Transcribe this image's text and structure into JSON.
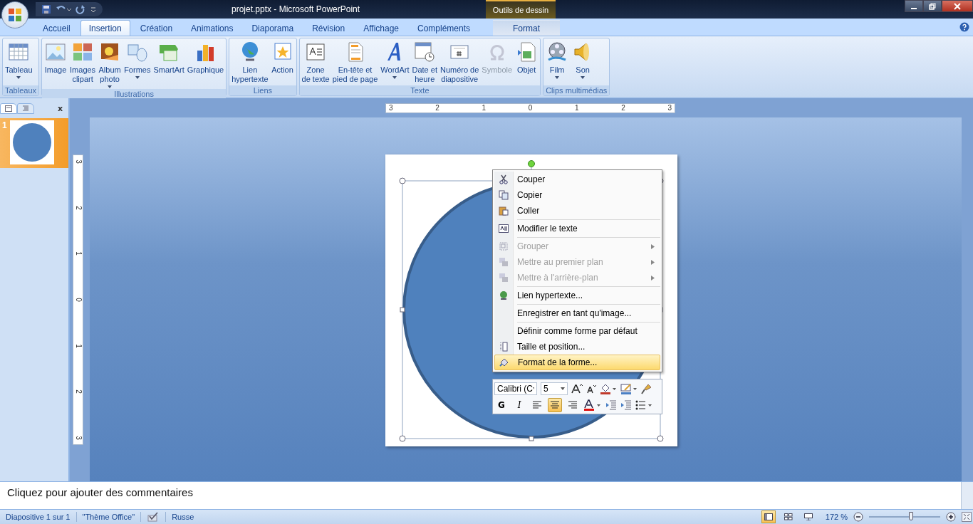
{
  "window": {
    "title": "projet.pptx - Microsoft PowerPoint",
    "contextual_title": "Outils de dessin"
  },
  "tabs": [
    {
      "label": "Accueil",
      "selected": false,
      "contextual": false
    },
    {
      "label": "Insertion",
      "selected": true,
      "contextual": false
    },
    {
      "label": "Création",
      "selected": false,
      "contextual": false
    },
    {
      "label": "Animations",
      "selected": false,
      "contextual": false
    },
    {
      "label": "Diaporama",
      "selected": false,
      "contextual": false
    },
    {
      "label": "Révision",
      "selected": false,
      "contextual": false
    },
    {
      "label": "Affichage",
      "selected": false,
      "contextual": false
    },
    {
      "label": "Compléments",
      "selected": false,
      "contextual": false
    },
    {
      "label": "Format",
      "selected": false,
      "contextual": true
    }
  ],
  "ribbon_groups": [
    {
      "label": "Tableaux",
      "buttons": [
        {
          "kind": "table",
          "lines": [
            "Tableau"
          ],
          "dropdown": true,
          "disabled": false
        }
      ]
    },
    {
      "label": "Illustrations",
      "buttons": [
        {
          "kind": "image",
          "lines": [
            "Image"
          ],
          "dropdown": false,
          "disabled": false
        },
        {
          "kind": "clipart",
          "lines": [
            "Images",
            "clipart"
          ],
          "dropdown": false,
          "disabled": false
        },
        {
          "kind": "album",
          "lines": [
            "Album",
            "photo"
          ],
          "dropdown": true,
          "disabled": false
        },
        {
          "kind": "shapes",
          "lines": [
            "Formes"
          ],
          "dropdown": true,
          "disabled": false
        },
        {
          "kind": "smartart",
          "lines": [
            "SmartArt"
          ],
          "dropdown": false,
          "disabled": false
        },
        {
          "kind": "chart",
          "lines": [
            "Graphique"
          ],
          "dropdown": false,
          "disabled": false
        }
      ]
    },
    {
      "label": "Liens",
      "buttons": [
        {
          "kind": "link",
          "lines": [
            "Lien",
            "hypertexte"
          ],
          "dropdown": false,
          "disabled": false
        },
        {
          "kind": "action",
          "lines": [
            "Action"
          ],
          "dropdown": false,
          "disabled": false
        }
      ]
    },
    {
      "label": "Texte",
      "buttons": [
        {
          "kind": "textbox",
          "lines": [
            "Zone",
            "de texte"
          ],
          "dropdown": false,
          "disabled": false
        },
        {
          "kind": "header",
          "lines": [
            "En-tête et",
            "pied de page"
          ],
          "dropdown": false,
          "disabled": false
        },
        {
          "kind": "wordart",
          "lines": [
            "WordArt"
          ],
          "dropdown": true,
          "disabled": false
        },
        {
          "kind": "date",
          "lines": [
            "Date et",
            "heure"
          ],
          "dropdown": false,
          "disabled": false
        },
        {
          "kind": "number",
          "lines": [
            "Numéro de",
            "diapositive"
          ],
          "dropdown": false,
          "disabled": false
        },
        {
          "kind": "symbol",
          "lines": [
            "Symbole"
          ],
          "dropdown": false,
          "disabled": true
        },
        {
          "kind": "object",
          "lines": [
            "Objet"
          ],
          "dropdown": false,
          "disabled": false
        }
      ]
    },
    {
      "label": "Clips multimédias",
      "buttons": [
        {
          "kind": "film",
          "lines": [
            "Film"
          ],
          "dropdown": true,
          "disabled": false
        },
        {
          "kind": "sound",
          "lines": [
            "Son"
          ],
          "dropdown": true,
          "disabled": false
        }
      ]
    }
  ],
  "slides_pane": {
    "close": "x",
    "slides": [
      {
        "number": "1",
        "selected": true
      }
    ]
  },
  "rulers": {
    "horizontal": [
      "3",
      "2",
      "1",
      "0",
      "1",
      "2",
      "3"
    ],
    "vertical": [
      "3",
      "2",
      "1",
      "0",
      "1",
      "2",
      "3"
    ]
  },
  "context_menu": [
    {
      "label": "Couper",
      "kind": "cut",
      "disabled": false,
      "submenu": false,
      "separator_before": false,
      "selected": false
    },
    {
      "label": "Copier",
      "kind": "copy",
      "disabled": false,
      "submenu": false,
      "separator_before": false,
      "selected": false
    },
    {
      "label": "Coller",
      "kind": "paste",
      "disabled": false,
      "submenu": false,
      "separator_before": false,
      "selected": false
    },
    {
      "label": "Modifier le texte",
      "kind": "text",
      "disabled": false,
      "submenu": false,
      "separator_before": true,
      "selected": false
    },
    {
      "label": "Grouper",
      "kind": "group",
      "disabled": true,
      "submenu": true,
      "separator_before": true,
      "selected": false
    },
    {
      "label": "Mettre au premier plan",
      "kind": "front",
      "disabled": true,
      "submenu": true,
      "separator_before": false,
      "selected": false
    },
    {
      "label": "Mettre à l'arrière-plan",
      "kind": "back",
      "disabled": true,
      "submenu": true,
      "separator_before": false,
      "selected": false
    },
    {
      "label": "Lien hypertexte...",
      "kind": "link",
      "disabled": false,
      "submenu": false,
      "separator_before": true,
      "selected": false
    },
    {
      "label": "Enregistrer en tant qu'image...",
      "kind": "plain",
      "disabled": false,
      "submenu": false,
      "separator_before": true,
      "selected": false
    },
    {
      "label": "Définir comme forme par défaut",
      "kind": "plain",
      "disabled": false,
      "submenu": false,
      "separator_before": true,
      "selected": false
    },
    {
      "label": "Taille et position...",
      "kind": "size",
      "disabled": false,
      "submenu": false,
      "separator_before": false,
      "selected": false
    },
    {
      "label": "Format de la forme...",
      "kind": "format",
      "disabled": false,
      "submenu": false,
      "separator_before": false,
      "selected": true
    }
  ],
  "mini_toolbar": {
    "font": "Calibri (C",
    "size": "5",
    "bold": "G",
    "italic": "I",
    "align": [
      {
        "kind": "left",
        "selected": false
      },
      {
        "kind": "center",
        "selected": true
      },
      {
        "kind": "right",
        "selected": false
      }
    ]
  },
  "notes": {
    "placeholder": "Cliquez pour ajouter des commentaires"
  },
  "status_bar": {
    "slide": "Diapositive 1 sur 1",
    "theme": "\"Thème Office\"",
    "language": "Russe",
    "zoom": "172 %",
    "zoom_slider": {
      "level": 0.59
    },
    "views": [
      {
        "kind": "normal",
        "selected": true
      },
      {
        "kind": "sorter",
        "selected": false
      },
      {
        "kind": "show",
        "selected": false
      }
    ]
  }
}
